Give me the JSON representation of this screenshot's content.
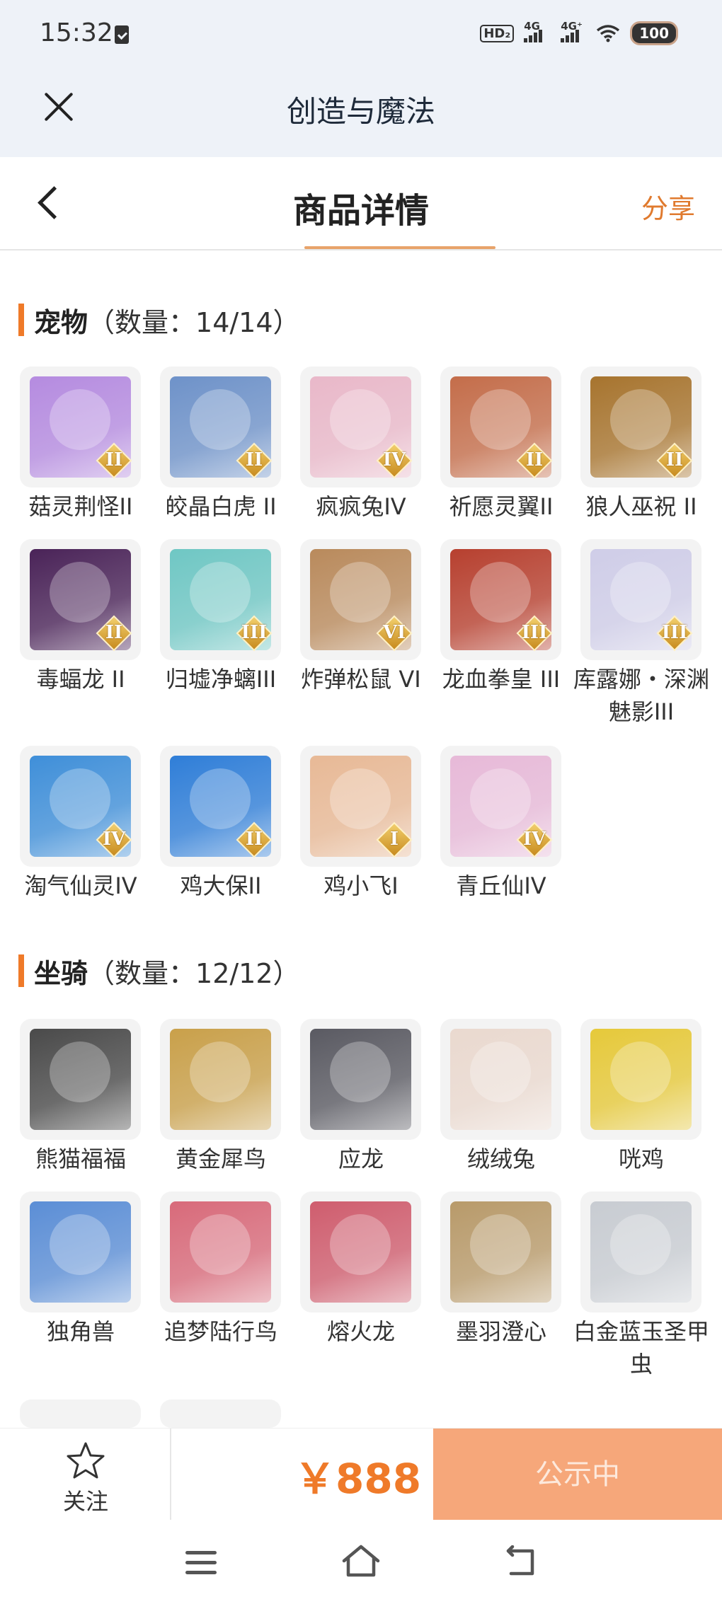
{
  "status_bar": {
    "time": "15:32",
    "hd": "HD₂",
    "signal1": "4G",
    "signal2": "4G⁺",
    "battery": "100"
  },
  "header": {
    "title": "创造与魔法"
  },
  "nav": {
    "title": "商品详情",
    "share": "分享"
  },
  "sections": [
    {
      "name": "宠物",
      "count": "（数量：14/14）",
      "items": [
        {
          "name": "菇灵荆怪II",
          "rank": "II",
          "color": "#b58be0"
        },
        {
          "name": "皎晶白虎 II",
          "rank": "II",
          "color": "#6e92c9"
        },
        {
          "name": "疯疯兔IV",
          "rank": "IV",
          "color": "#e9b8c9"
        },
        {
          "name": "祈愿灵翼II",
          "rank": "II",
          "color": "#c46d4a"
        },
        {
          "name": "狼人巫祝 II",
          "rank": "II",
          "color": "#a7742e"
        },
        {
          "name": "毒蝠龙 II",
          "rank": "II",
          "color": "#4a2358"
        },
        {
          "name": "归墟净螭III",
          "rank": "III",
          "color": "#6fc7c4"
        },
        {
          "name": "炸弹松鼠 VI",
          "rank": "VI",
          "color": "#b98a5c"
        },
        {
          "name": "龙血拳皇 III",
          "rank": "III",
          "color": "#b7402f"
        },
        {
          "name": "库露娜・深渊魅影III",
          "rank": "III",
          "color": "#cfcde8"
        },
        {
          "name": "淘气仙灵IV",
          "rank": "IV",
          "color": "#3f8fd9"
        },
        {
          "name": "鸡大保II",
          "rank": "II",
          "color": "#2f7ed8"
        },
        {
          "name": "鸡小飞I",
          "rank": "I",
          "color": "#e8b996"
        },
        {
          "name": "青丘仙IV",
          "rank": "IV",
          "color": "#e7b9d8"
        }
      ]
    },
    {
      "name": "坐骑",
      "count": "（数量：12/12）",
      "items": [
        {
          "name": "熊猫福福",
          "rank": "",
          "color": "#4a4a4a"
        },
        {
          "name": "黄金犀鸟",
          "rank": "",
          "color": "#c9a04a"
        },
        {
          "name": "应龙",
          "rank": "",
          "color": "#5a5a62"
        },
        {
          "name": "绒绒兔",
          "rank": "",
          "color": "#ead9cf"
        },
        {
          "name": "咣鸡",
          "rank": "",
          "color": "#e6c93a"
        },
        {
          "name": "独角兽",
          "rank": "",
          "color": "#5b8ed6"
        },
        {
          "name": "追梦陆行鸟",
          "rank": "",
          "color": "#d86a7a"
        },
        {
          "name": "熔火龙",
          "rank": "",
          "color": "#cf5d6e"
        },
        {
          "name": "墨羽澄心",
          "rank": "",
          "color": "#b89a6a"
        },
        {
          "name": "白金蓝玉圣甲虫",
          "rank": "",
          "color": "#c8ccd2"
        }
      ]
    }
  ],
  "bottom": {
    "follow": "关注",
    "price": "￥888",
    "cta": "公示中"
  }
}
